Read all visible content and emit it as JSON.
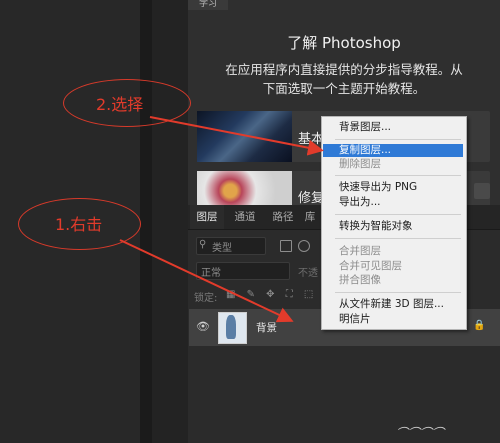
{
  "learn_panel": {
    "tab_label": "学习",
    "title": "了解 Photoshop",
    "desc_line1": "在应用程序内直接提供的分步指导教程。从",
    "desc_line2": "下面选取一个主题开始教程。",
    "cards": [
      {
        "label": "基本"
      },
      {
        "label": "修复"
      }
    ]
  },
  "layers_panel": {
    "tabs": [
      "图层",
      "通道",
      "路径",
      "库"
    ],
    "filter_label": "类型",
    "blend_mode": "正常",
    "opacity_label": "不透",
    "lock_label": "锁定:",
    "lock_icons": "▦ ✎ ✥ ⛶ ⬚",
    "layer": {
      "name": "背景",
      "visible_icon": "eye-icon",
      "locked_icon": "lock-icon"
    }
  },
  "context_menu": {
    "items": [
      {
        "label": "背景图层...",
        "state": "normal"
      },
      {
        "label": "复制图层...",
        "state": "highlight"
      },
      {
        "label": "删除图层",
        "state": "disabled"
      },
      {
        "label": "快速导出为 PNG",
        "state": "normal"
      },
      {
        "label": "导出为...",
        "state": "normal"
      },
      {
        "label": "转换为智能对象",
        "state": "normal"
      },
      {
        "label": "合并图层",
        "state": "disabled"
      },
      {
        "label": "合并可见图层",
        "state": "disabled"
      },
      {
        "label": "拼合图像",
        "state": "disabled"
      },
      {
        "label": "从文件新建 3D 图层...",
        "state": "normal"
      },
      {
        "label": "明信片",
        "state": "normal"
      }
    ]
  },
  "annotations": {
    "step1": "1.右击",
    "step2": "2.选择",
    "color": "#e23b2b"
  },
  "watermark": "⌒⌒⌒⌒"
}
